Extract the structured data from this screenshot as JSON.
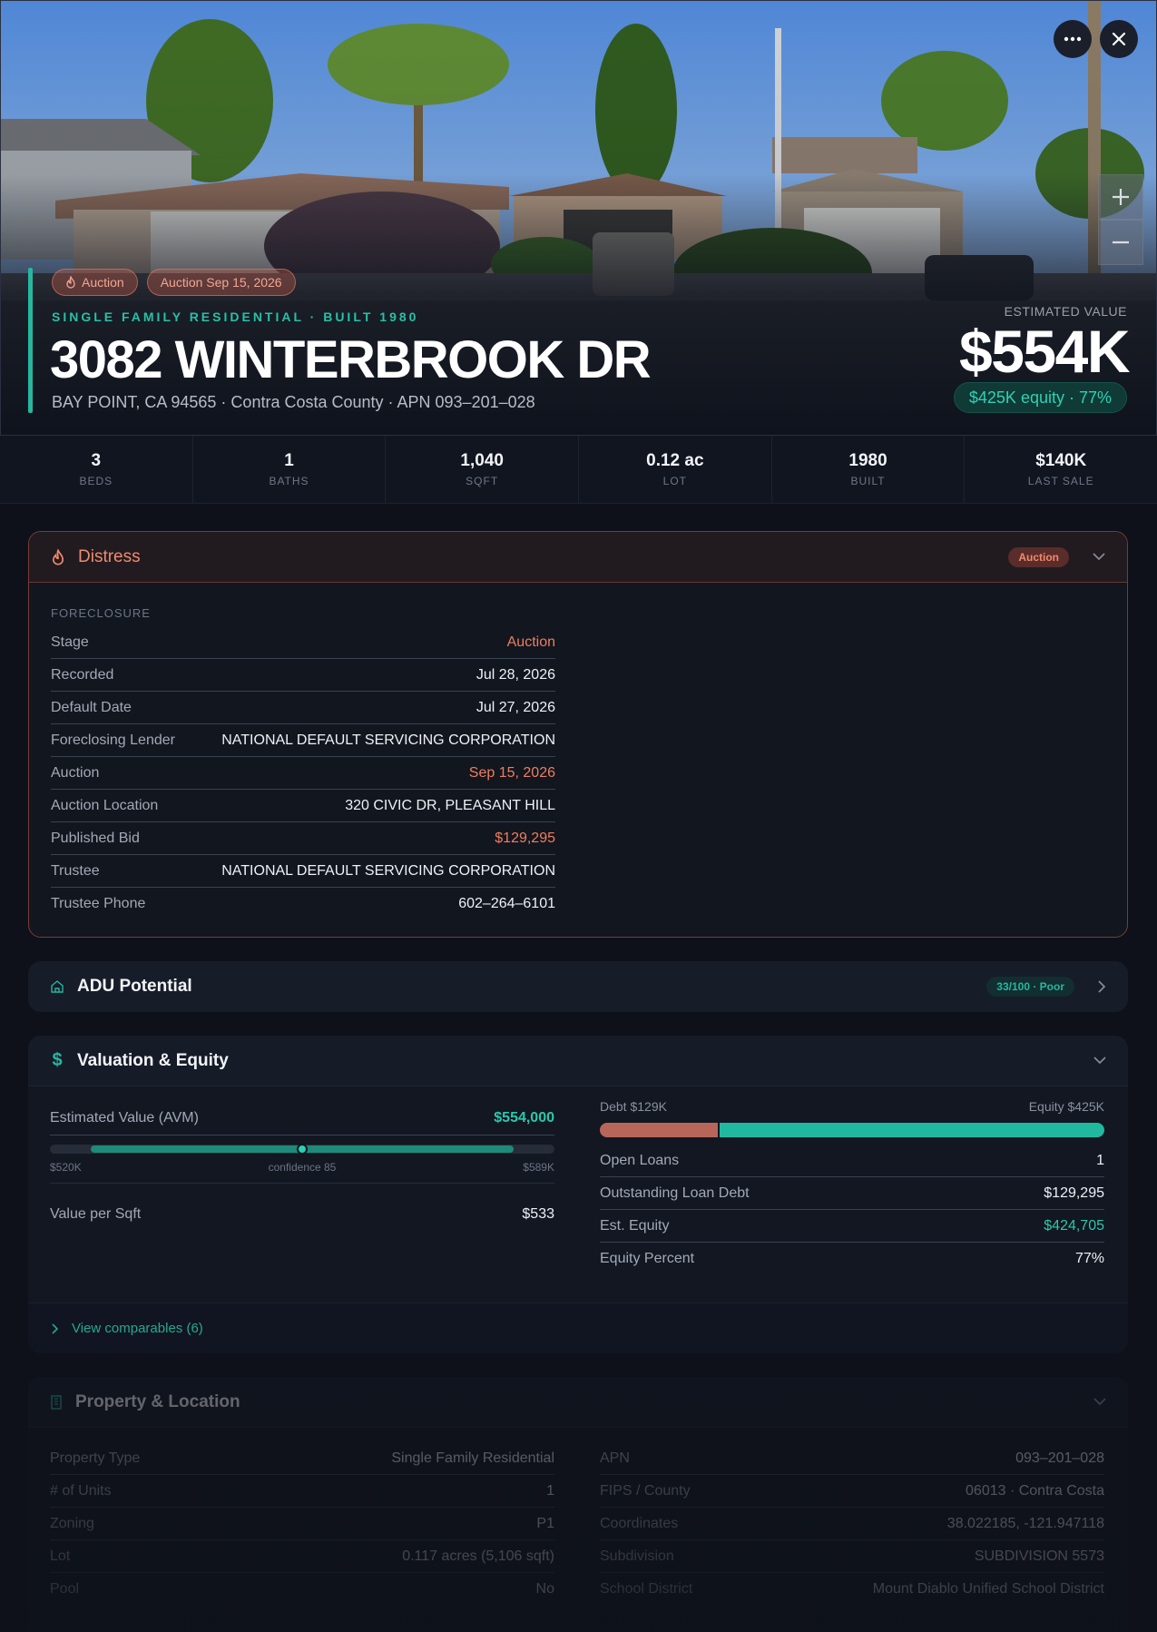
{
  "hero": {
    "pill_auction": "Auction",
    "pill_auction_date": "Auction Sep 15, 2026",
    "eyebrow": "SINGLE FAMILY RESIDENTIAL · BUILT 1980",
    "address": "3082 WINTERBROOK DR",
    "subaddress": "BAY POINT, CA 94565 · Contra Costa County · APN 093–201–028",
    "est_label": "ESTIMATED VALUE",
    "est_value": "$554K",
    "equity_badge": "$425K equity · 77%",
    "colors": {
      "accent": "#25b7a0",
      "distress": "#ee7e5f"
    }
  },
  "stats": [
    {
      "value": "3",
      "label": "BEDS"
    },
    {
      "value": "1",
      "label": "BATHS"
    },
    {
      "value": "1,040",
      "label": "SQFT"
    },
    {
      "value": "0.12 ac",
      "label": "LOT"
    },
    {
      "value": "1980",
      "label": "BUILT"
    },
    {
      "value": "$140K",
      "label": "LAST SALE"
    }
  ],
  "distress": {
    "title": "Distress",
    "tag": "Auction",
    "section": "FORECLOSURE",
    "rows": [
      {
        "k": "Stage",
        "v": "Auction"
      },
      {
        "k": "Recorded",
        "v": "Jul 28, 2026"
      },
      {
        "k": "Default Date",
        "v": "Jul 27, 2026"
      },
      {
        "k": "Foreclosing Lender",
        "v": "NATIONAL DEFAULT SERVICING CORPORATION"
      },
      {
        "k": "Auction",
        "v": "Sep 15, 2026"
      },
      {
        "k": "Auction Location",
        "v": "320 CIVIC DR, PLEASANT HILL"
      },
      {
        "k": "Published Bid",
        "v": "$129,295"
      },
      {
        "k": "Trustee",
        "v": "NATIONAL DEFAULT SERVICING CORPORATION"
      },
      {
        "k": "Trustee Phone",
        "v": "602–264–6101"
      }
    ]
  },
  "adu": {
    "title": "ADU Potential",
    "score": "33/100 · Poor"
  },
  "valuation": {
    "title": "Valuation & Equity",
    "avm_label": "Estimated Value (AVM)",
    "avm_value": "$554,000",
    "range_low": "$520K",
    "range_mid": "confidence 85",
    "range_high": "$589K",
    "confidence": 85,
    "vps_label": "Value per Sqft",
    "vps_value": "$533",
    "debt_label": "Debt $129K",
    "equity_label": "Equity $425K",
    "equity_fraction": 0.767,
    "rows": [
      {
        "k": "Open Loans",
        "v": "1"
      },
      {
        "k": "Outstanding Loan Debt",
        "v": "$129,295"
      },
      {
        "k": "Est. Equity",
        "v": "$424,705"
      },
      {
        "k": "Equity Percent",
        "v": "77%"
      }
    ],
    "comparables": "View comparables (6)"
  },
  "property": {
    "title": "Property & Location",
    "left": [
      {
        "k": "Property Type",
        "v": "Single Family Residential"
      },
      {
        "k": "# of Units",
        "v": "1"
      },
      {
        "k": "Zoning",
        "v": "P1"
      },
      {
        "k": "Lot",
        "v": "0.117 acres (5,106 sqft)"
      },
      {
        "k": "Pool",
        "v": "No"
      }
    ],
    "right": [
      {
        "k": "APN",
        "v": "093–201–028"
      },
      {
        "k": "FIPS / County",
        "v": "06013 · Contra Costa"
      },
      {
        "k": "Coordinates",
        "v": "38.022185, -121.947118"
      },
      {
        "k": "Subdivision",
        "v": "SUBDIVISION 5573"
      },
      {
        "k": "School District",
        "v": "Mount Diablo Unified School District"
      }
    ]
  }
}
